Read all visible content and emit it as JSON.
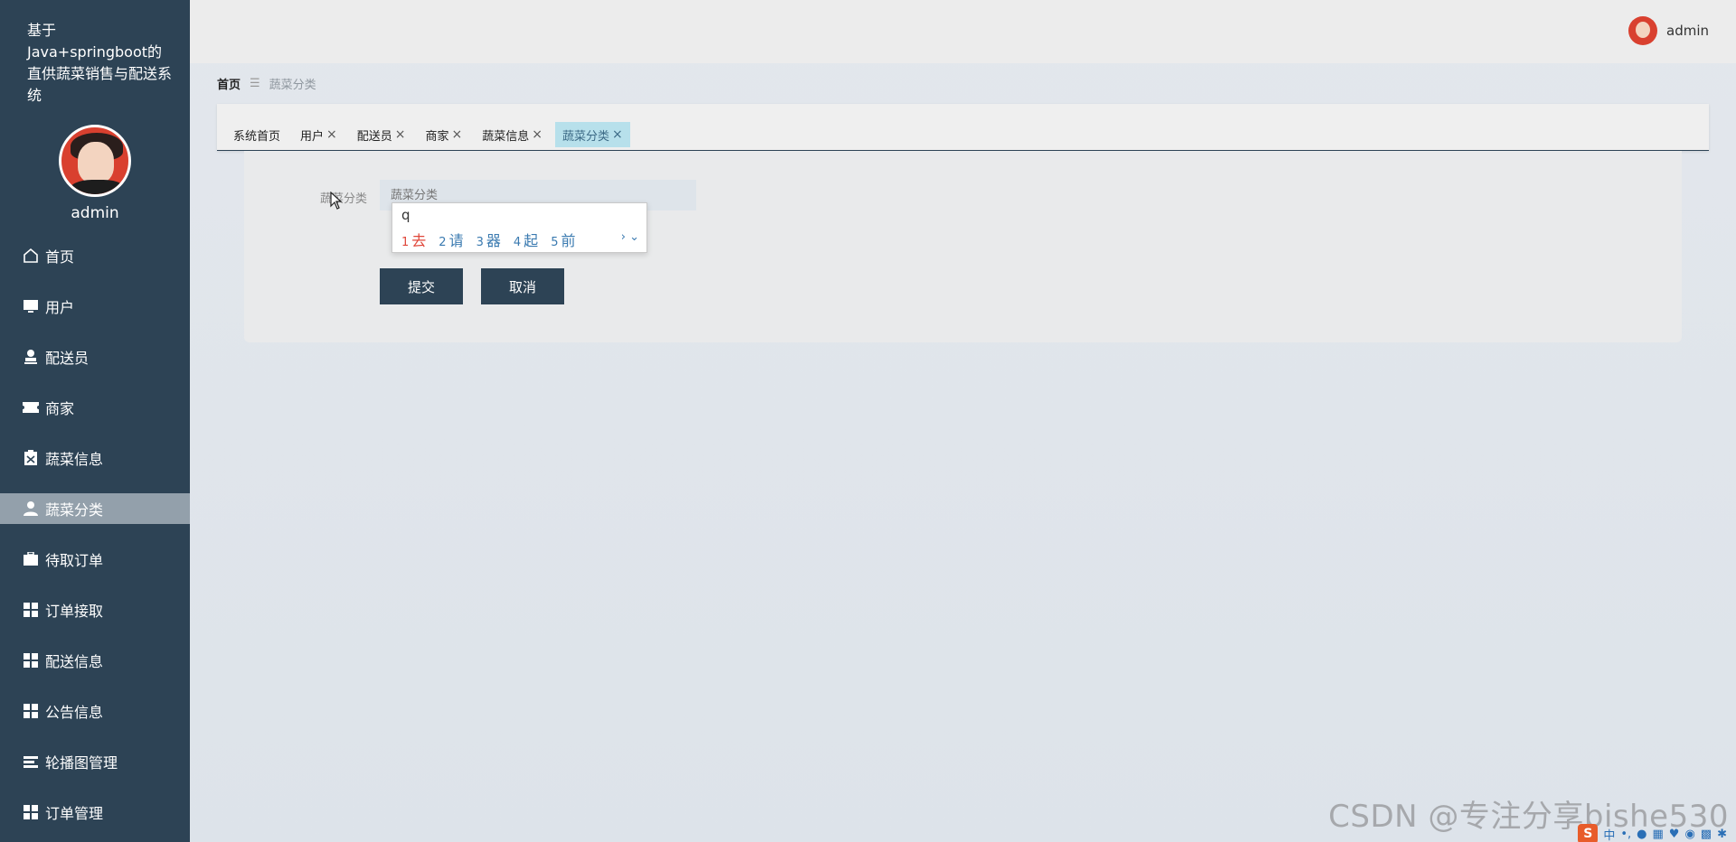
{
  "sidebar": {
    "title": "基于Java+springboot的直供蔬菜销售与配送系统",
    "username": "admin",
    "items": [
      {
        "label": "首页",
        "icon": "home-icon"
      },
      {
        "label": "用户",
        "icon": "monitor-icon"
      },
      {
        "label": "配送员",
        "icon": "stamp-icon"
      },
      {
        "label": "商家",
        "icon": "ticket-icon"
      },
      {
        "label": "蔬菜信息",
        "icon": "clipboard-icon"
      },
      {
        "label": "蔬菜分类",
        "icon": "user-icon",
        "active": true
      },
      {
        "label": "待取订单",
        "icon": "briefcase-icon"
      },
      {
        "label": "订单接取",
        "icon": "grid-icon"
      },
      {
        "label": "配送信息",
        "icon": "grid-icon"
      },
      {
        "label": "公告信息",
        "icon": "grid-icon"
      },
      {
        "label": "轮播图管理",
        "icon": "list-icon"
      },
      {
        "label": "订单管理",
        "icon": "grid-icon"
      }
    ]
  },
  "topbar": {
    "username": "admin"
  },
  "breadcrumb": {
    "home": "首页",
    "separator": "☰",
    "current": "蔬菜分类"
  },
  "tabs": [
    {
      "label": "系统首页",
      "closable": false
    },
    {
      "label": "用户",
      "closable": true
    },
    {
      "label": "配送员",
      "closable": true
    },
    {
      "label": "商家",
      "closable": true
    },
    {
      "label": "蔬菜信息",
      "closable": true
    },
    {
      "label": "蔬菜分类",
      "closable": true,
      "active": true
    }
  ],
  "form": {
    "field_label": "蔬菜分类",
    "field_placeholder": "蔬菜分类",
    "submit_label": "提交",
    "cancel_label": "取消"
  },
  "ime": {
    "input": "q",
    "candidates": [
      {
        "num": "1",
        "text": "去"
      },
      {
        "num": "2",
        "text": "请"
      },
      {
        "num": "3",
        "text": "器"
      },
      {
        "num": "4",
        "text": "起"
      },
      {
        "num": "5",
        "text": "前"
      }
    ],
    "more": "› ⌄"
  },
  "watermark": "CSDN @专注分享bishe530",
  "tray": {
    "logo": "S",
    "lang": "中"
  },
  "colors": {
    "sidebar_bg": "#2d4355",
    "active_menu_bg": "#93a0ab",
    "active_tab_bg": "#b7e0eb",
    "button_bg": "#2d4355"
  }
}
